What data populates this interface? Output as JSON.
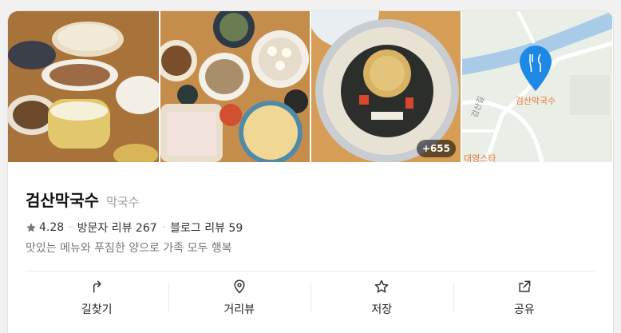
{
  "gallery": {
    "more_count": "+655",
    "map_road_label": "검산길",
    "map_place_label": "검산막국수",
    "map_partial_label": "대영스타"
  },
  "place": {
    "name": "검산막국수",
    "category": "막국수",
    "rating": "4.28",
    "visitor_reviews": "방문자 리뷰 267",
    "blog_reviews": "블로그 리뷰 59",
    "description": "맛있는 메뉴와 푸짐한 양으로 가족 모두 행복"
  },
  "actions": [
    {
      "label": "길찾기",
      "icon": "directions-icon"
    },
    {
      "label": "거리뷰",
      "icon": "location-pin-icon"
    },
    {
      "label": "저장",
      "icon": "star-icon"
    },
    {
      "label": "공유",
      "icon": "share-icon"
    }
  ],
  "colors": {
    "map_pin": "#1e88e5",
    "map_place_label": "#e8763a",
    "star": "#777777"
  }
}
